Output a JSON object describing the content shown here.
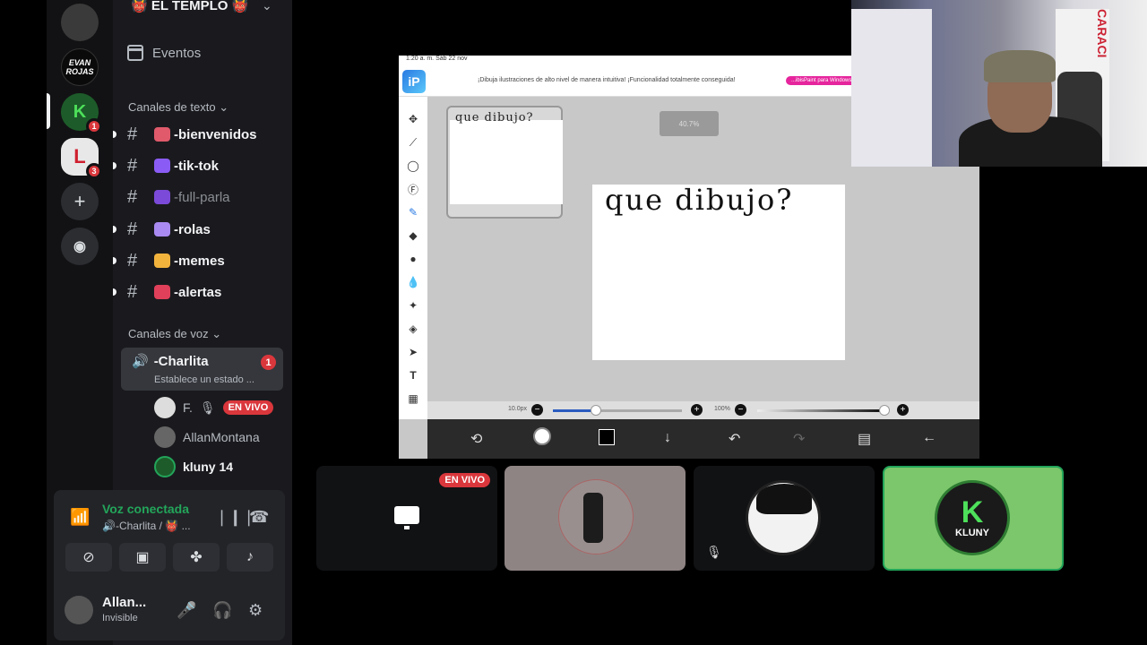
{
  "servers": [
    {
      "label": "",
      "badge": ""
    },
    {
      "label": "EVAN ROJAS",
      "badge": ""
    },
    {
      "label": "K",
      "badge": "1"
    },
    {
      "label": "L",
      "badge": "3"
    }
  ],
  "guild": {
    "name": "👹 EL TEMPLO 👹"
  },
  "sidebar": {
    "eventos": "Eventos",
    "text_category": "Canales de texto",
    "voice_category": "Canales de voz",
    "text_channels": [
      {
        "name": "-bienvenidos",
        "emoji_color": "#e05a6b"
      },
      {
        "name": "-tik-tok",
        "emoji_color": "#8a5cf5"
      },
      {
        "name": "-full-parla",
        "emoji_color": "#7b4ad8"
      },
      {
        "name": "-rolas",
        "emoji_color": "#a98af0"
      },
      {
        "name": "-memes",
        "emoji_color": "#f2b33d"
      },
      {
        "name": "-alertas",
        "emoji_color": "#e0405a"
      }
    ],
    "voice_channel": {
      "name": "-Charlita",
      "status": "Establece un estado ...",
      "badge": "1",
      "users": [
        {
          "name": "F.",
          "live": "EN VIVO"
        },
        {
          "name": "AllanMontana"
        },
        {
          "name": "kluny 14"
        }
      ]
    }
  },
  "panel": {
    "voice_connected": "Voz conectada",
    "voice_sub": "🔊-Charlita / 👹 ...",
    "user_name": "Allan...",
    "user_status": "Invisible"
  },
  "stream": {
    "status_time": "1:20 a. m.   Sáb 22 nov",
    "banner": "¡Dibuja ilustraciones de alto nivel de manera intuitiva! ¡Funcionalidad totalmente conseguida!",
    "banner_pill": "...ibisPaint para Windows di...",
    "zoom": "40.7%",
    "layer_text": "que dibujo?",
    "canvas_text": "que dibujo?",
    "brush_size": "10.0px",
    "opacity": "100%"
  },
  "tiles": {
    "live_label": "EN VIVO",
    "kluny_label": "KLUNY"
  },
  "webcam": {
    "poster_text": "CARACI"
  }
}
